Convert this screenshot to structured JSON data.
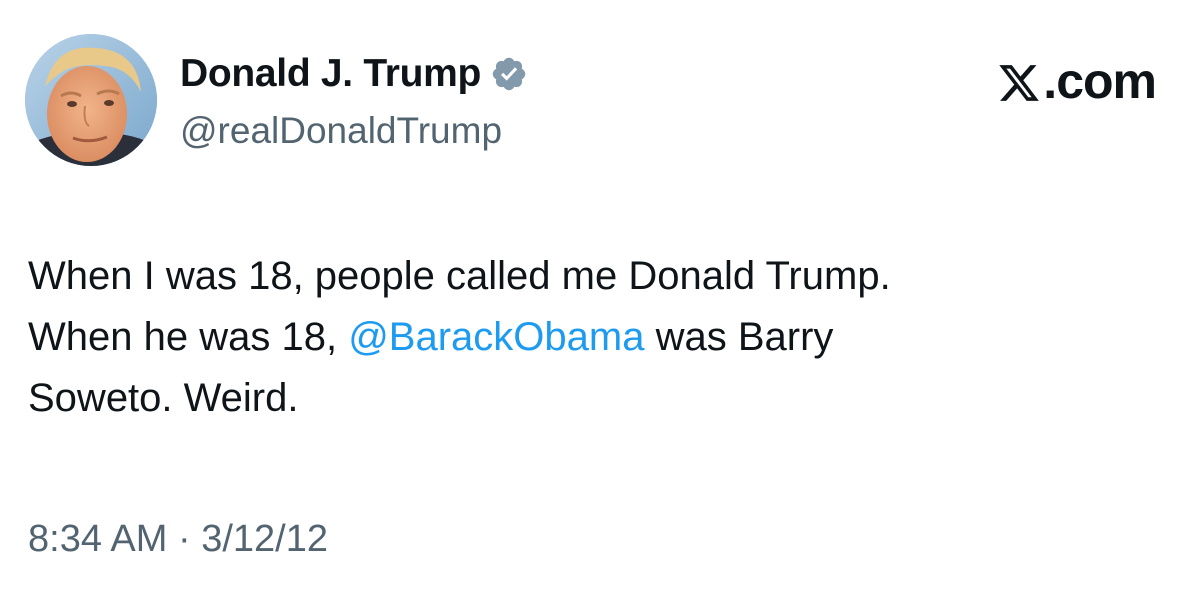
{
  "author": {
    "display_name": "Donald J. Trump",
    "handle": "@realDonaldTrump",
    "verified_icon": "verified-badge-icon",
    "avatar_icon": "profile-photo"
  },
  "brand": {
    "icon": "x-logo-icon",
    "label": ".com"
  },
  "tweet": {
    "line1": "When I was 18, people called me Donald Trump.",
    "line2_before": "When he was 18, ",
    "mention": "@BarackObama",
    "line2_after": " was Barry",
    "line3": "Soweto. Weird."
  },
  "meta": {
    "time": "8:34 AM",
    "separator": " · ",
    "date": "3/12/12"
  },
  "colors": {
    "link": "#1d9bf0",
    "secondary_text": "#536471",
    "verified_badge": "#829aab",
    "primary_text": "#0f1419"
  }
}
